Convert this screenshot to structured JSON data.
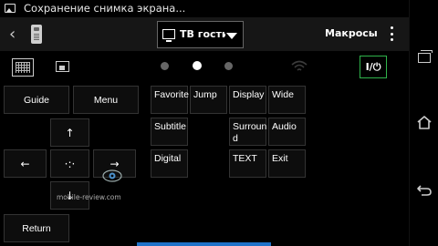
{
  "statusbar": {
    "title": "Сохранение снимка экрана..."
  },
  "actionbar": {
    "device_label": "ТВ гости",
    "macros_label": "Макросы"
  },
  "pager": {
    "page_count": 3,
    "active_page": 2
  },
  "power_label": "I/⏻",
  "left_pad": {
    "guide": "Guide",
    "menu": "Menu",
    "up": "↑",
    "left": "←",
    "right": "→",
    "down": "↓",
    "center": "·:·",
    "return": "Return"
  },
  "grid_buttons": {
    "favorite": "Favorite",
    "jump": "Jump",
    "display": "Display",
    "wide": "Wide",
    "subtitle": "Subtitle",
    "surround": "Surroun d",
    "audio": "Audio",
    "digital": "Digital",
    "text": "TEXT",
    "exit": "Exit"
  },
  "watermark": "mobile-review.com",
  "colors": {
    "power_border": "#2fb24b",
    "accent": "#1f72c8"
  }
}
